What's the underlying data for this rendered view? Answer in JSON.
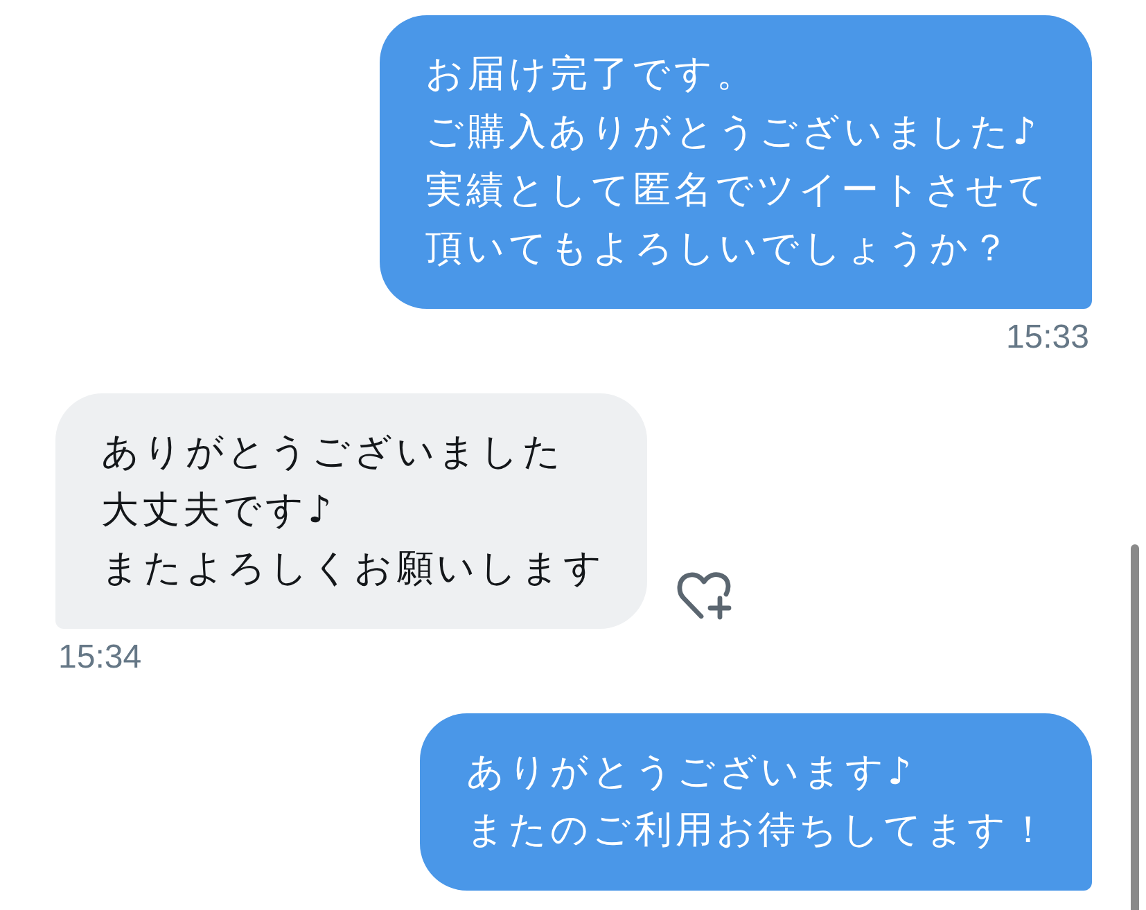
{
  "messages": [
    {
      "kind": "sent",
      "lines": [
        "お届け完了です。",
        "ご購入ありがとうございました♪",
        "実績として匿名でツイートさせて",
        "頂いてもよろしいでしょうか？"
      ],
      "time": "15:33"
    },
    {
      "kind": "received",
      "lines": [
        "ありがとうございました",
        "大丈夫です♪",
        "またよろしくお願いします"
      ],
      "time": "15:34"
    },
    {
      "kind": "sent",
      "lines": [
        "ありがとうございます♪",
        "またのご利用お待ちしてます！"
      ]
    }
  ]
}
